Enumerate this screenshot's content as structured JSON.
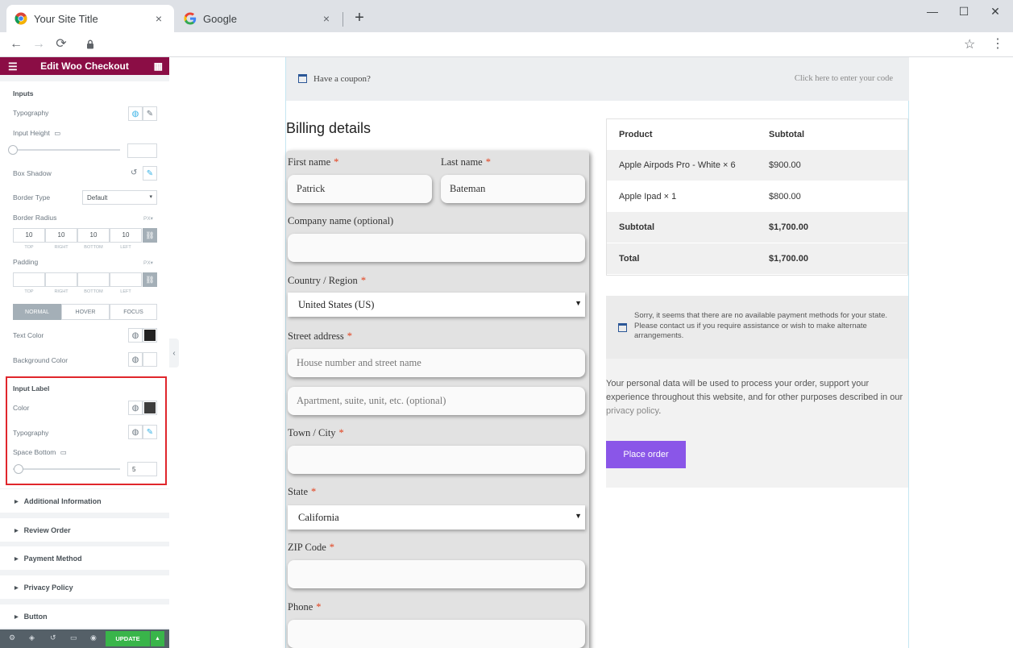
{
  "browser": {
    "tabs": [
      {
        "title": "Your Site Title",
        "icon": "chrome-icon"
      },
      {
        "title": "Google",
        "icon": "google-icon"
      }
    ],
    "new_tab": "+",
    "close": "×",
    "window_controls": {
      "minimize": "—",
      "maximize": "☐",
      "close": "✕"
    }
  },
  "panel": {
    "title": "Edit Woo Checkout",
    "inputs_section": {
      "title": "Inputs",
      "typography": "Typography",
      "input_height": "Input Height",
      "box_shadow": "Box Shadow",
      "border_type": "Border Type",
      "border_type_value": "Default",
      "border_radius": "Border Radius",
      "unit": "PX",
      "radius_values": [
        "10",
        "10",
        "10",
        "10"
      ],
      "dim_captions": [
        "TOP",
        "RIGHT",
        "BOTTOM",
        "LEFT"
      ],
      "padding": "Padding",
      "state_tabs": [
        "NORMAL",
        "HOVER",
        "FOCUS"
      ],
      "text_color": "Text Color",
      "background_color": "Background Color"
    },
    "input_label": {
      "title": "Input Label",
      "color": "Color",
      "typography": "Typography",
      "space_bottom": "Space Bottom",
      "space_bottom_value": "5"
    },
    "accordions": [
      "Additional Information",
      "Review Order",
      "Payment Method",
      "Privacy Policy",
      "Button"
    ],
    "update_label": "UPDATE"
  },
  "coupon": {
    "text": "Have a coupon?",
    "link": "Click here to enter your code"
  },
  "billing": {
    "title": "Billing details",
    "first_name_label": "First name",
    "first_name_value": "Patrick",
    "last_name_label": "Last name",
    "last_name_value": "Bateman",
    "company_label": "Company name (optional)",
    "country_label": "Country / Region",
    "country_value": "United States (US)",
    "street_label": "Street address",
    "street_placeholder_1": "House number and street name",
    "street_placeholder_2": "Apartment, suite, unit, etc. (optional)",
    "city_label": "Town / City",
    "state_label": "State",
    "state_value": "California",
    "zip_label": "ZIP Code",
    "phone_label": "Phone",
    "required_mark": "*"
  },
  "order": {
    "header": {
      "product": "Product",
      "subtotal": "Subtotal"
    },
    "items": [
      {
        "product": "Apple Airpods Pro - White  × 6",
        "subtotal": "$900.00"
      },
      {
        "product": "Apple Ipad  × 1",
        "subtotal": "$800.00"
      }
    ],
    "subtotal": {
      "label": "Subtotal",
      "value": "$1,700.00"
    },
    "total": {
      "label": "Total",
      "value": "$1,700.00"
    }
  },
  "payment": {
    "notice": "Sorry, it seems that there are no available payment methods for your state. Please contact us if you require assistance or wish to make alternate arrangements.",
    "privacy_text": "Your personal data will be used to process your order, support your experience throughout this website, and for other purposes described in our ",
    "privacy_link": "privacy policy",
    "privacy_end": ".",
    "place_order": "Place order"
  },
  "colors": {
    "panel_header": "#8b0d45",
    "update_button": "#39b54a",
    "place_order": "#8a56e8",
    "highlight": "#e0262c",
    "required": "#e2401c"
  }
}
